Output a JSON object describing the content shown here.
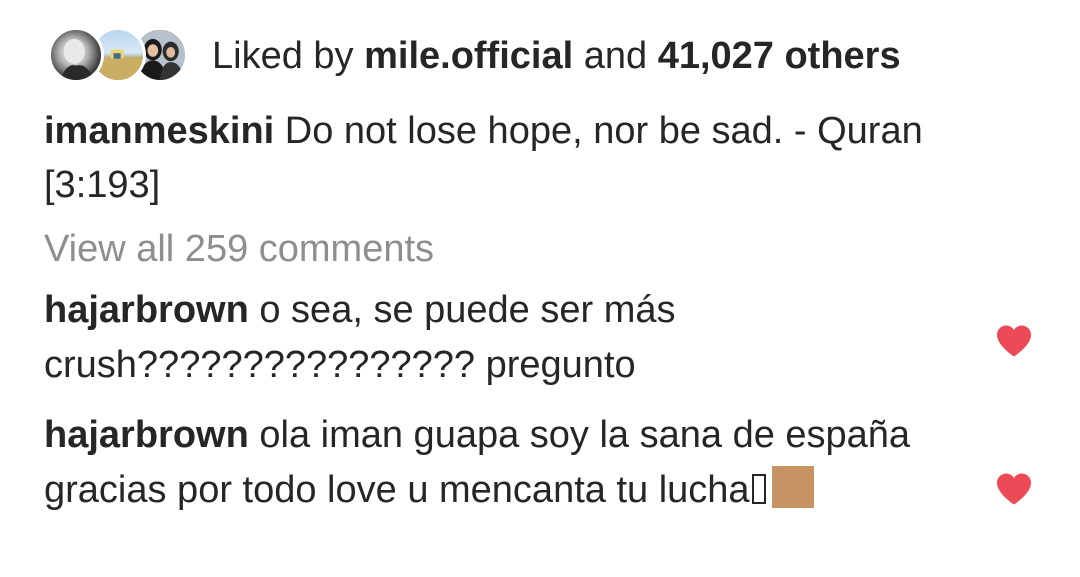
{
  "likes": {
    "prefix": "Liked by ",
    "user": "mile.official",
    "middle": " and ",
    "count": "41,027 others",
    "avatars": [
      "avatar-1",
      "avatar-2",
      "avatar-3"
    ]
  },
  "caption": {
    "username": "imanmeskini",
    "text": " Do not lose hope, nor be sad. - Quran [3:193]"
  },
  "view_all": "View all 259 comments",
  "comments": [
    {
      "username": "hajarbrown",
      "text": " o sea, se puede ser más crush???????????????? pregunto",
      "liked_icon": "heart-icon"
    },
    {
      "username": "hajarbrown",
      "text": " ola iman guapa soy la sana de españa gracias por todo love u mencanta tu lucha",
      "liked_icon": "heart-icon"
    }
  ],
  "colors": {
    "text": "#262626",
    "muted": "#8e8e8e",
    "heart": "#ed4956",
    "skin_tone_emoji": "#c69463"
  }
}
